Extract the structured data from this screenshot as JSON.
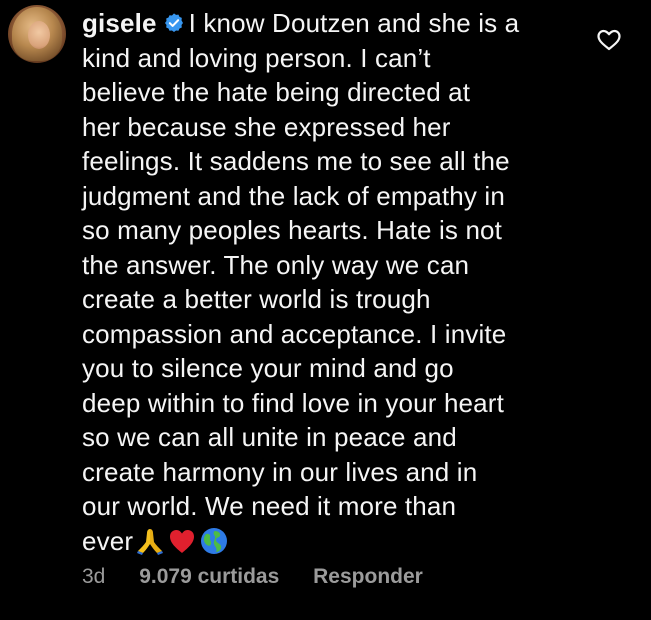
{
  "comment": {
    "username": "gisele",
    "lines": [
      "I know Doutzen and she is a",
      "kind and loving person. I can’t",
      "believe the hate being directed at",
      "her because she expressed her",
      "feelings. It saddens me to see all the",
      "judgment and the lack of empathy in",
      "so many peoples hearts. Hate is not",
      "the answer. The only way we can",
      "create a better world is trough",
      "compassion and acceptance. I invite",
      "you to silence your mind and go",
      "deep within to find love in your heart",
      "so we can all unite in peace and",
      "create harmony in our lives and in",
      "our world. We need it more than",
      "ever"
    ],
    "emojis": [
      "🙏",
      "❤️",
      "🌍"
    ]
  },
  "meta": {
    "time": "3d",
    "likes": "9.079 curtidas",
    "reply": "Responder"
  },
  "icons": {
    "verified": "verified-badge-icon",
    "like": "heart-outline-icon"
  },
  "colors": {
    "background": "#000000",
    "text": "#f5f5f5",
    "muted": "#9b9b9b",
    "verified": "#3897f0"
  }
}
